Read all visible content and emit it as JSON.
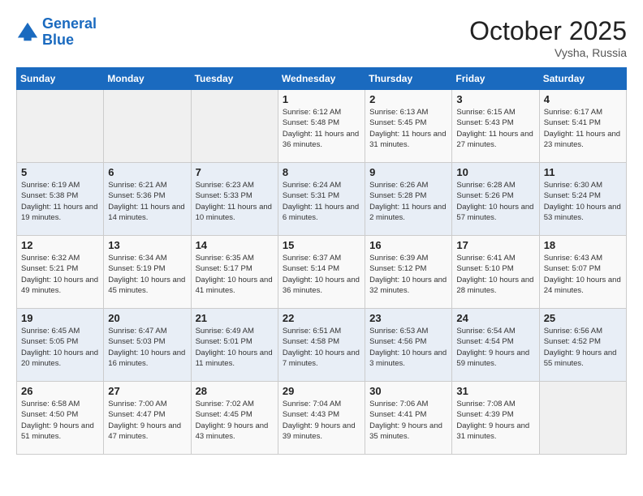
{
  "header": {
    "logo_line1": "General",
    "logo_line2": "Blue",
    "month": "October 2025",
    "location": "Vysha, Russia"
  },
  "days_of_week": [
    "Sunday",
    "Monday",
    "Tuesday",
    "Wednesday",
    "Thursday",
    "Friday",
    "Saturday"
  ],
  "weeks": [
    [
      {
        "day": "",
        "info": ""
      },
      {
        "day": "",
        "info": ""
      },
      {
        "day": "",
        "info": ""
      },
      {
        "day": "1",
        "info": "Sunrise: 6:12 AM\nSunset: 5:48 PM\nDaylight: 11 hours and 36 minutes."
      },
      {
        "day": "2",
        "info": "Sunrise: 6:13 AM\nSunset: 5:45 PM\nDaylight: 11 hours and 31 minutes."
      },
      {
        "day": "3",
        "info": "Sunrise: 6:15 AM\nSunset: 5:43 PM\nDaylight: 11 hours and 27 minutes."
      },
      {
        "day": "4",
        "info": "Sunrise: 6:17 AM\nSunset: 5:41 PM\nDaylight: 11 hours and 23 minutes."
      }
    ],
    [
      {
        "day": "5",
        "info": "Sunrise: 6:19 AM\nSunset: 5:38 PM\nDaylight: 11 hours and 19 minutes."
      },
      {
        "day": "6",
        "info": "Sunrise: 6:21 AM\nSunset: 5:36 PM\nDaylight: 11 hours and 14 minutes."
      },
      {
        "day": "7",
        "info": "Sunrise: 6:23 AM\nSunset: 5:33 PM\nDaylight: 11 hours and 10 minutes."
      },
      {
        "day": "8",
        "info": "Sunrise: 6:24 AM\nSunset: 5:31 PM\nDaylight: 11 hours and 6 minutes."
      },
      {
        "day": "9",
        "info": "Sunrise: 6:26 AM\nSunset: 5:28 PM\nDaylight: 11 hours and 2 minutes."
      },
      {
        "day": "10",
        "info": "Sunrise: 6:28 AM\nSunset: 5:26 PM\nDaylight: 10 hours and 57 minutes."
      },
      {
        "day": "11",
        "info": "Sunrise: 6:30 AM\nSunset: 5:24 PM\nDaylight: 10 hours and 53 minutes."
      }
    ],
    [
      {
        "day": "12",
        "info": "Sunrise: 6:32 AM\nSunset: 5:21 PM\nDaylight: 10 hours and 49 minutes."
      },
      {
        "day": "13",
        "info": "Sunrise: 6:34 AM\nSunset: 5:19 PM\nDaylight: 10 hours and 45 minutes."
      },
      {
        "day": "14",
        "info": "Sunrise: 6:35 AM\nSunset: 5:17 PM\nDaylight: 10 hours and 41 minutes."
      },
      {
        "day": "15",
        "info": "Sunrise: 6:37 AM\nSunset: 5:14 PM\nDaylight: 10 hours and 36 minutes."
      },
      {
        "day": "16",
        "info": "Sunrise: 6:39 AM\nSunset: 5:12 PM\nDaylight: 10 hours and 32 minutes."
      },
      {
        "day": "17",
        "info": "Sunrise: 6:41 AM\nSunset: 5:10 PM\nDaylight: 10 hours and 28 minutes."
      },
      {
        "day": "18",
        "info": "Sunrise: 6:43 AM\nSunset: 5:07 PM\nDaylight: 10 hours and 24 minutes."
      }
    ],
    [
      {
        "day": "19",
        "info": "Sunrise: 6:45 AM\nSunset: 5:05 PM\nDaylight: 10 hours and 20 minutes."
      },
      {
        "day": "20",
        "info": "Sunrise: 6:47 AM\nSunset: 5:03 PM\nDaylight: 10 hours and 16 minutes."
      },
      {
        "day": "21",
        "info": "Sunrise: 6:49 AM\nSunset: 5:01 PM\nDaylight: 10 hours and 11 minutes."
      },
      {
        "day": "22",
        "info": "Sunrise: 6:51 AM\nSunset: 4:58 PM\nDaylight: 10 hours and 7 minutes."
      },
      {
        "day": "23",
        "info": "Sunrise: 6:53 AM\nSunset: 4:56 PM\nDaylight: 10 hours and 3 minutes."
      },
      {
        "day": "24",
        "info": "Sunrise: 6:54 AM\nSunset: 4:54 PM\nDaylight: 9 hours and 59 minutes."
      },
      {
        "day": "25",
        "info": "Sunrise: 6:56 AM\nSunset: 4:52 PM\nDaylight: 9 hours and 55 minutes."
      }
    ],
    [
      {
        "day": "26",
        "info": "Sunrise: 6:58 AM\nSunset: 4:50 PM\nDaylight: 9 hours and 51 minutes."
      },
      {
        "day": "27",
        "info": "Sunrise: 7:00 AM\nSunset: 4:47 PM\nDaylight: 9 hours and 47 minutes."
      },
      {
        "day": "28",
        "info": "Sunrise: 7:02 AM\nSunset: 4:45 PM\nDaylight: 9 hours and 43 minutes."
      },
      {
        "day": "29",
        "info": "Sunrise: 7:04 AM\nSunset: 4:43 PM\nDaylight: 9 hours and 39 minutes."
      },
      {
        "day": "30",
        "info": "Sunrise: 7:06 AM\nSunset: 4:41 PM\nDaylight: 9 hours and 35 minutes."
      },
      {
        "day": "31",
        "info": "Sunrise: 7:08 AM\nSunset: 4:39 PM\nDaylight: 9 hours and 31 minutes."
      },
      {
        "day": "",
        "info": ""
      }
    ]
  ]
}
